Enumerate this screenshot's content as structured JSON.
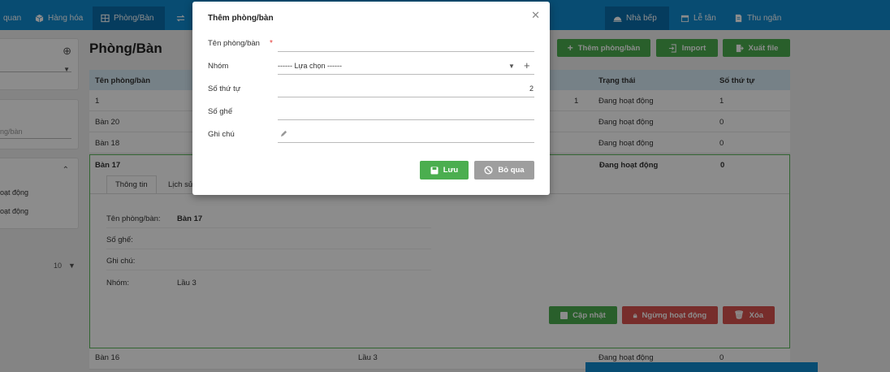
{
  "nav": {
    "items": [
      {
        "label": "quan"
      },
      {
        "label": "Hàng hóa"
      },
      {
        "label": "Phòng/Bàn"
      },
      {
        "label": ""
      }
    ],
    "right_items": [
      {
        "label": "Nhà bếp"
      },
      {
        "label": "Lễ tân"
      },
      {
        "label": "Thu ngân"
      }
    ]
  },
  "sidebar": {
    "search_placeholder": "ng/bàn",
    "status_items": [
      {
        "label": "oạt động"
      },
      {
        "label": "oạt động"
      }
    ],
    "page_size": "10"
  },
  "page": {
    "title": "Phòng/Bàn",
    "actions": {
      "add": "Thêm phòng/bàn",
      "import": "Import",
      "export": "Xuất file"
    }
  },
  "table": {
    "columns": {
      "name": "Tên phòng/bàn",
      "status": "Trạng thái",
      "order": "Số thứ tự"
    },
    "rows": [
      {
        "name": "1",
        "count": "1",
        "status": "Đang hoạt động",
        "order": "1"
      },
      {
        "name": "Bàn 20",
        "status": "Đang hoạt động",
        "order": "0"
      },
      {
        "name": "Bàn 18",
        "status": "Đang hoạt động",
        "order": "0"
      },
      {
        "name": "Bàn 17",
        "status": "Đang hoạt động",
        "order": "0"
      }
    ],
    "detail": {
      "tabs": [
        "Thông tin",
        "Lịch sử"
      ],
      "fields": [
        {
          "label": "Tên phòng/bàn:",
          "value": "Bàn 17"
        },
        {
          "label": "Số ghế:",
          "value": ""
        },
        {
          "label": "Ghi chú:",
          "value": ""
        },
        {
          "label": "Nhóm:",
          "value": "Lầu 3"
        }
      ],
      "buttons": {
        "update": "Cập nhật",
        "stop": "Ngừng hoạt động",
        "delete": "Xóa"
      }
    },
    "last_row": {
      "name": "Bàn 16",
      "group": "Lầu 3",
      "status": "Đang hoạt động",
      "order": "0"
    }
  },
  "modal": {
    "title": "Thêm phòng/bàn",
    "fields": {
      "name_label": "Tên phòng/bàn",
      "group_label": "Nhóm",
      "group_value": "------ Lựa chọn ------",
      "order_label": "Số thứ tự",
      "order_value": "2",
      "seats_label": "Số ghế",
      "note_label": "Ghi chú"
    },
    "save": "Lưu",
    "cancel": "Bỏ qua"
  },
  "colors": {
    "nav": "#0f8ad0",
    "green": "#4bae4f",
    "red": "#d9534f",
    "gray": "#9e9e9e",
    "header": "#d7ecf6"
  }
}
